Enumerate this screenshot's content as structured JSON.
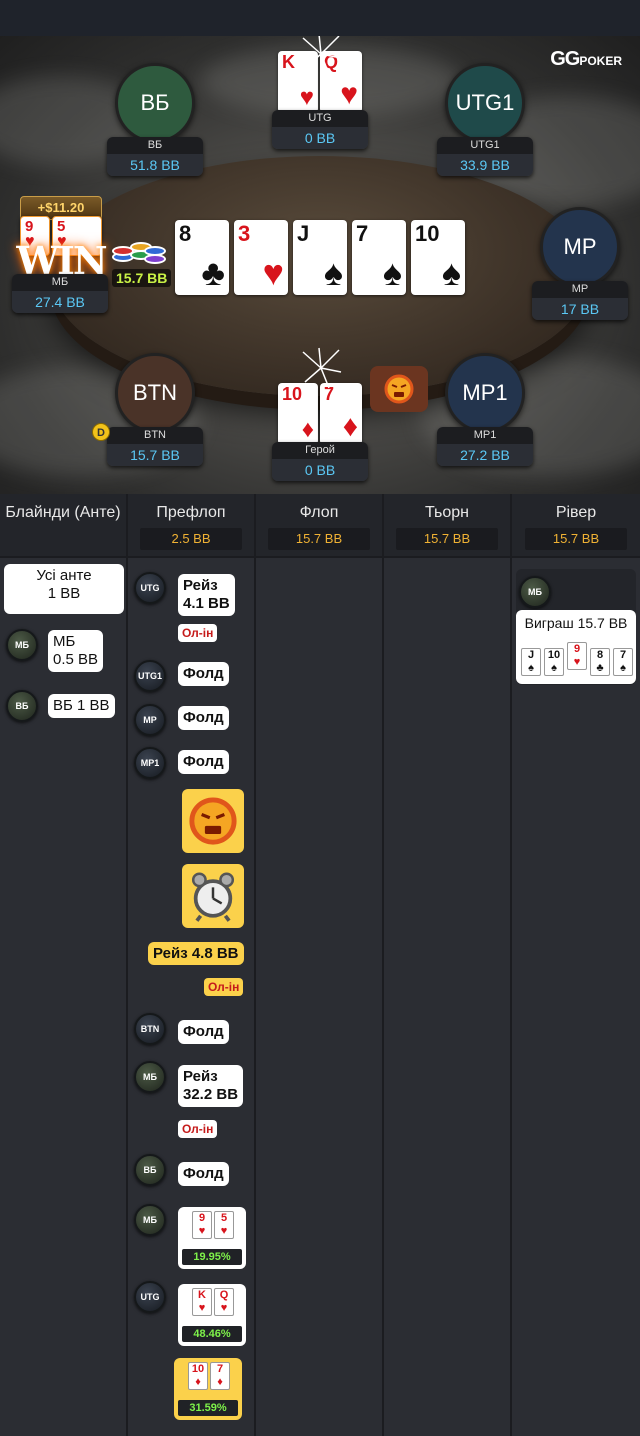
{
  "logo": {
    "brand": "GG",
    "sub": "POKER"
  },
  "seats": {
    "bb": {
      "avatar": "ВБ",
      "name": "ВБ",
      "stack": "51.8 BB",
      "color": "#2e5a3e"
    },
    "utg1": {
      "avatar": "UTG1",
      "name": "UTG1",
      "stack": "33.9 BB",
      "color": "#1f4a4a"
    },
    "mp": {
      "avatar": "MP",
      "name": "MP",
      "stack": "17 BB",
      "color": "#23344d"
    },
    "mp1": {
      "avatar": "MP1",
      "name": "MP1",
      "stack": "27.2 BB",
      "color": "#23344d"
    },
    "btn": {
      "avatar": "BTN",
      "name": "BTN",
      "stack": "15.7 BB",
      "color": "#4a3328"
    },
    "sb": {
      "name": "МБ",
      "stack": "27.4 BB"
    },
    "utg": {
      "name": "UTG",
      "stack": "0 BB"
    },
    "hero": {
      "name": "Герой",
      "stack": "0 BB"
    }
  },
  "win": {
    "amount": "+$11.20",
    "text": "WIN"
  },
  "pot": "15.7 BB",
  "dealer_button": "D",
  "board": [
    {
      "rank": "8",
      "suit": "♣",
      "color": "blk"
    },
    {
      "rank": "3",
      "suit": "♥",
      "color": "red"
    },
    {
      "rank": "J",
      "suit": "♠",
      "color": "blk"
    },
    {
      "rank": "7",
      "suit": "♠",
      "color": "blk"
    },
    {
      "rank": "10",
      "suit": "♠",
      "color": "blk"
    }
  ],
  "hole_cards": {
    "utg": [
      {
        "rank": "K",
        "suit": "♥"
      },
      {
        "rank": "Q",
        "suit": "♥"
      }
    ],
    "hero": [
      {
        "rank": "10",
        "suit": "♦"
      },
      {
        "rank": "7",
        "suit": "♦"
      }
    ],
    "sb": [
      {
        "rank": "9",
        "suit": "♥"
      },
      {
        "rank": "5",
        "suit": "♥"
      }
    ]
  },
  "streets": [
    {
      "title": "Блайнди (Анте)",
      "pot": ""
    },
    {
      "title": "Префлоп",
      "pot": "2.5 BB"
    },
    {
      "title": "Флоп",
      "pot": "15.7 BB"
    },
    {
      "title": "Тьорн",
      "pot": "15.7 BB"
    },
    {
      "title": "Рівер",
      "pot": "15.7 BB"
    }
  ],
  "blinds": {
    "ante": "Усі анте\n1 BB",
    "sb_chip": "МБ",
    "sb_text": "МБ\n0.5 BB",
    "bb_chip": "ВБ",
    "bb_text": "ВБ 1 BB"
  },
  "preflop": {
    "utg_chip": "UTG",
    "utg_action": "Рейз\n4.1 BB",
    "allin": "Ол-ін",
    "utg1_chip": "UTG1",
    "utg1_action": "Фолд",
    "mp_chip": "MP",
    "mp_action": "Фолд",
    "mp1_chip": "MP1",
    "mp1_action": "Фолд",
    "hero_action": "Рейз 4.8 BB",
    "btn_chip": "BTN",
    "btn_action": "Фолд",
    "sb_chip": "МБ",
    "sb_action": "Рейз\n32.2 BB",
    "bb_chip": "ВБ",
    "bb_action": "Фолд",
    "sb_equity": "19.95%",
    "utg_equity": "48.46%",
    "hero_equity": "31.59%"
  },
  "river": {
    "chip": "МБ",
    "result": "Виграш 15.7 BB",
    "cards": [
      {
        "rank": "J",
        "suit": "♠",
        "color": "blk"
      },
      {
        "rank": "10",
        "suit": "♠",
        "color": "blk"
      },
      {
        "rank": "9",
        "suit": "♥",
        "color": "red"
      },
      {
        "rank": "8",
        "suit": "♣",
        "color": "blk"
      },
      {
        "rank": "7",
        "suit": "♠",
        "color": "blk"
      }
    ]
  }
}
